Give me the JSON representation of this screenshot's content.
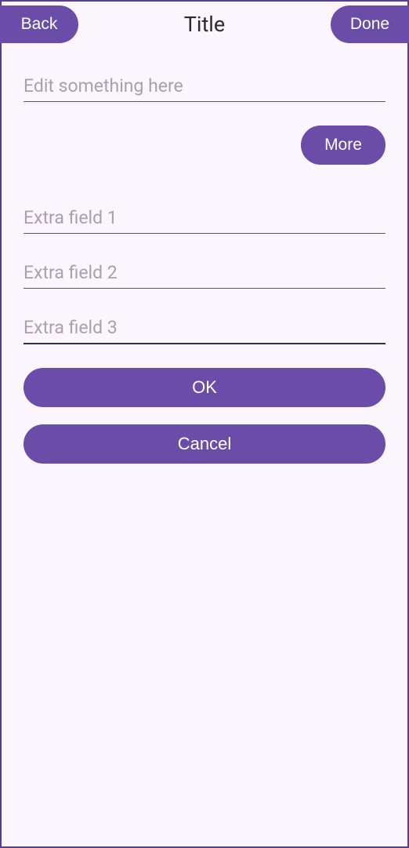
{
  "header": {
    "back_label": "Back",
    "title": "Title",
    "done_label": "Done"
  },
  "main_input": {
    "placeholder": "Edit something here",
    "value": ""
  },
  "more_label": "More",
  "extra_fields": [
    {
      "placeholder": "Extra field 1",
      "value": ""
    },
    {
      "placeholder": "Extra field 2",
      "value": ""
    },
    {
      "placeholder": "Extra field 3",
      "value": ""
    }
  ],
  "buttons": {
    "ok_label": "OK",
    "cancel_label": "Cancel"
  },
  "colors": {
    "accent": "#6b4ca8",
    "background": "#fbf6fd",
    "border": "#5b3a9e"
  }
}
